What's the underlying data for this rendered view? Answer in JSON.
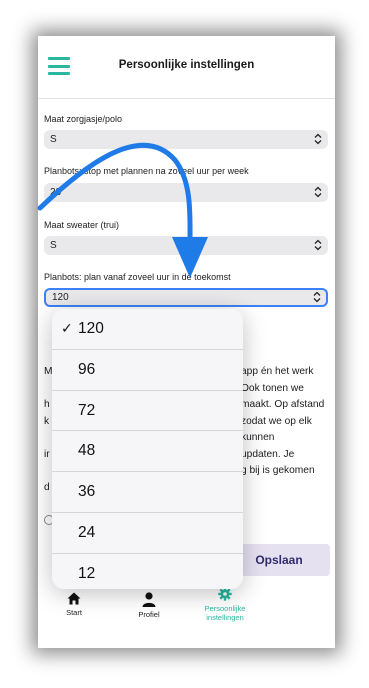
{
  "header": {
    "title": "Persoonlijke instellingen",
    "menu_icon": "hamburger-icon"
  },
  "fields": [
    {
      "label": "Maat zorgjasje/polo",
      "value": "S"
    },
    {
      "label": "Planbots: stop met plannen na zoveel uur per week",
      "value": "23"
    },
    {
      "label": "Maat sweater (trui)",
      "value": "S"
    },
    {
      "label": "Planbots: plan vanaf zoveel uur in de toekomst",
      "value": "120"
    }
  ],
  "dropdown": {
    "options": [
      "120",
      "96",
      "72",
      "48",
      "36",
      "24",
      "12"
    ],
    "selected": "120",
    "check_glyph": "✓"
  },
  "body_lines": [
    "M",
    "h",
    "k",
    "ir",
    "d"
  ],
  "body_lines_right": [
    "app én het werk",
    "Ook tonen we",
    "maakt. Op afstand",
    "zodat we op elk",
    "kunnen",
    "updaten. Je",
    "g bij is gekomen"
  ],
  "save_button": {
    "label": "Opslaan"
  },
  "tabs": [
    {
      "label": "Start",
      "icon": "home-icon"
    },
    {
      "label": "Profiel",
      "icon": "person-icon"
    },
    {
      "label": "Persoonlijke instellingen",
      "icon": "gear-icon"
    }
  ],
  "colors": {
    "accent": "#2bb6a0",
    "focus_border": "#3b82f6",
    "annotation_arrow": "#1e7be8",
    "save_button_bg": "#e6e1f1",
    "save_button_text": "#2f2d6e"
  }
}
